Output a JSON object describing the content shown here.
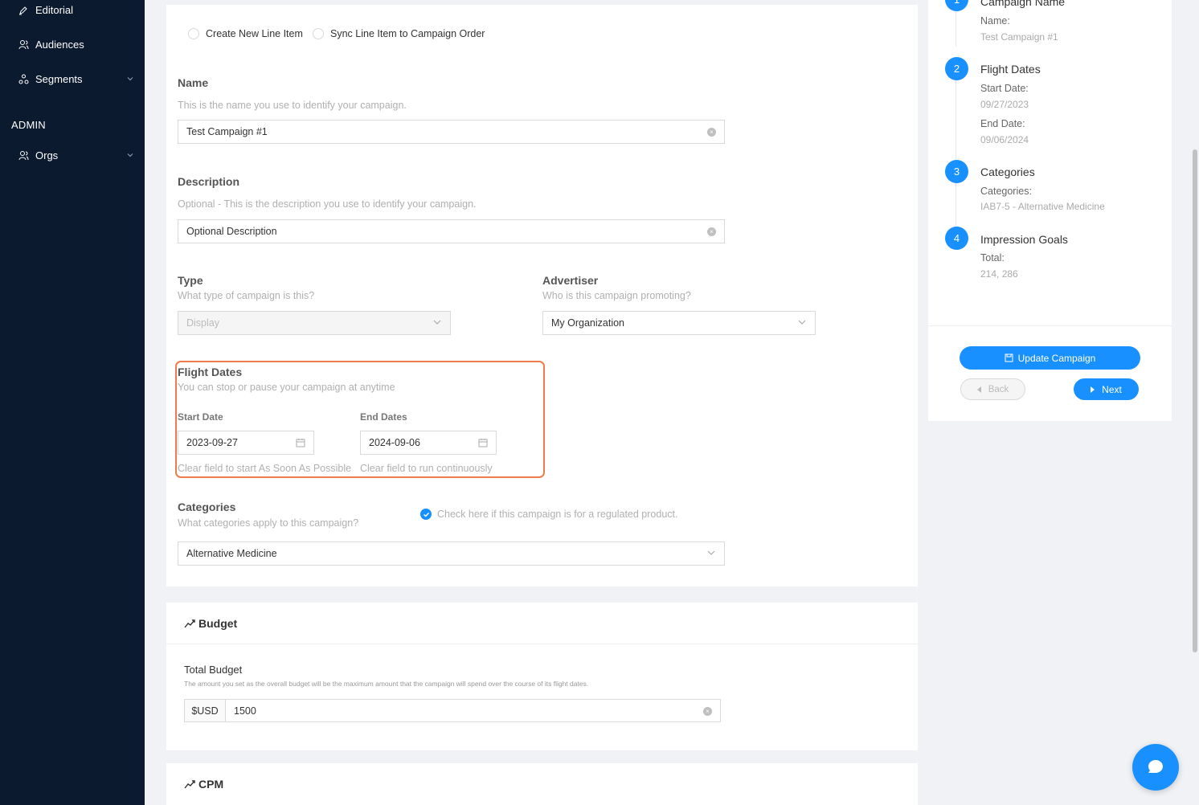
{
  "sidebar": {
    "items": [
      {
        "label": "Editorial",
        "icon": "pen-icon"
      },
      {
        "label": "Audiences",
        "icon": "users-icon"
      },
      {
        "label": "Segments",
        "icon": "segments-icon",
        "expandable": true
      },
      {
        "label": "Orgs",
        "icon": "users-icon",
        "expandable": true
      }
    ],
    "admin_section": "ADMIN"
  },
  "line_item": {
    "create_label": "Create New Line Item",
    "sync_label": "Sync Line Item to Campaign Order"
  },
  "name": {
    "label": "Name",
    "help": "This is the name you use to identify your campaign.",
    "value": "Test Campaign #1"
  },
  "description": {
    "label": "Description",
    "help": "Optional - This is the description you use to identify your campaign.",
    "value": "Optional Description"
  },
  "type": {
    "label": "Type",
    "help": "What type of campaign is this?",
    "value": "Display"
  },
  "advertiser": {
    "label": "Advertiser",
    "help": "Who is this campaign promoting?",
    "value": "My Organization"
  },
  "flight_dates": {
    "label": "Flight Dates",
    "help": "You can stop or pause your campaign at anytime",
    "start_label": "Start Date",
    "start_value": "2023-09-27",
    "start_help": "Clear field to start As Soon As Possible",
    "end_label": "End Dates",
    "end_value": "2024-09-06",
    "end_help": "Clear field to run continuously"
  },
  "categories": {
    "label": "Categories",
    "help": "What categories apply to this campaign?",
    "regulated_label": "Check here if this campaign is for a regulated product.",
    "value": "Alternative Medicine"
  },
  "budget": {
    "title": "Budget",
    "total_label": "Total Budget",
    "total_help": "The amount you set as the overall budget will be the maximum amount that the campaign will spend over the course of its flight dates.",
    "currency": "$USD",
    "value": "1500"
  },
  "cpm": {
    "title": "CPM"
  },
  "summary": {
    "steps": [
      {
        "num": "1",
        "title": "Campaign Name",
        "fields": [
          {
            "key": "Name:",
            "value": "Test Campaign #1"
          }
        ]
      },
      {
        "num": "2",
        "title": "Flight Dates",
        "fields": [
          {
            "key": "Start Date:",
            "value": "09/27/2023"
          },
          {
            "key": "End Date:",
            "value": "09/06/2024"
          }
        ]
      },
      {
        "num": "3",
        "title": "Categories",
        "fields": [
          {
            "key": "Categories:",
            "value": "IAB7-5 - Alternative Medicine"
          }
        ]
      },
      {
        "num": "4",
        "title": "Impression Goals",
        "fields": [
          {
            "key": "Total:",
            "value": "214, 286"
          }
        ]
      }
    ],
    "update_label": "Update Campaign",
    "back_label": "Back",
    "next_label": "Next"
  },
  "colors": {
    "sidebar_bg": "#0c1a30",
    "primary": "#1890ff",
    "highlight": "#f07b4a"
  }
}
